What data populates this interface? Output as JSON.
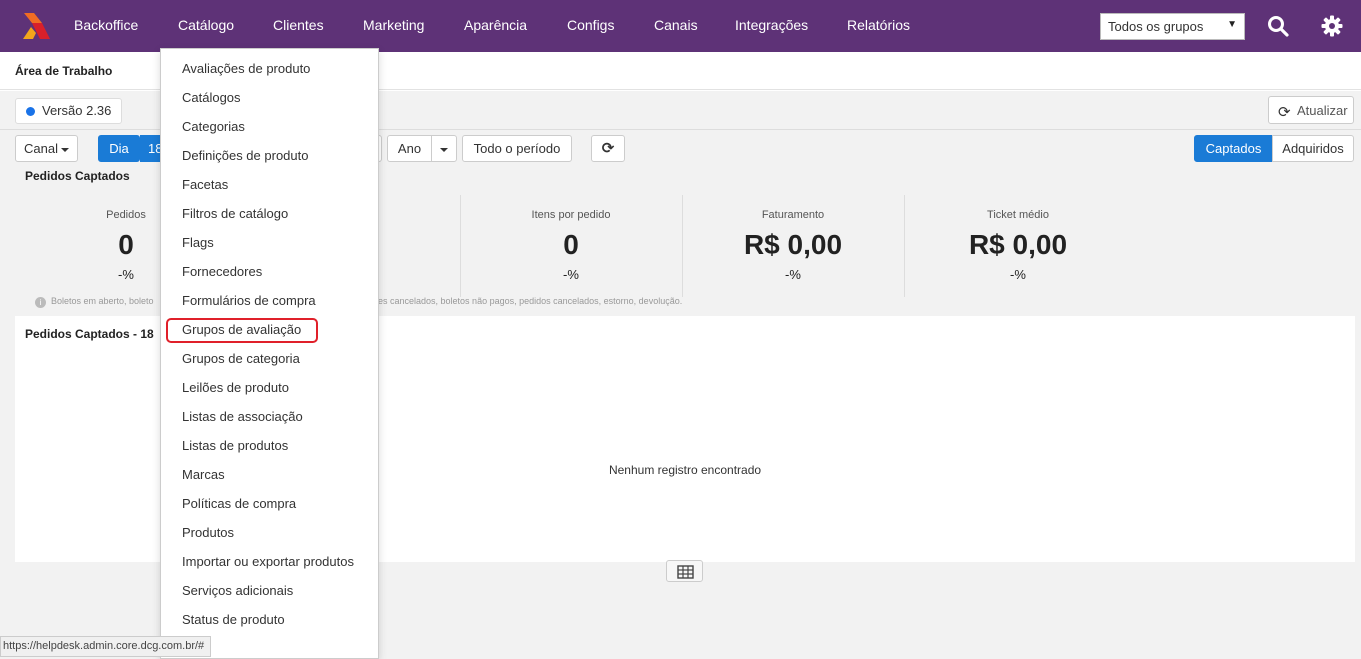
{
  "nav": {
    "items": [
      "Backoffice",
      "Catálogo",
      "Clientes",
      "Marketing",
      "Aparência",
      "Configs",
      "Canais",
      "Integrações",
      "Relatórios"
    ],
    "group_select": "Todos os grupos",
    "icons": [
      "search-icon",
      "gear-icon"
    ],
    "brand_color": "#5e3277"
  },
  "page": {
    "title": "Área de Trabalho",
    "version": "Versão 2.36",
    "refresh_label": "Atualizar"
  },
  "toolbar": {
    "canal": "Canal",
    "dia": "Dia",
    "dia_partial": "18",
    "ano": "Ano",
    "todo_periodo": "Todo o período",
    "captados": "Captados",
    "adquiridos": "Adquiridos"
  },
  "summary": {
    "title": "Pedidos Captados",
    "metrics": [
      {
        "label": "Pedidos",
        "value": "0",
        "pct": "-%"
      },
      {
        "label": "Itens por pedido",
        "value": "0",
        "pct": "-%"
      },
      {
        "label": "Faturamento",
        "value": "R$ 0,00",
        "pct": "-%"
      },
      {
        "label": "Ticket médio",
        "value": "R$ 0,00",
        "pct": "-%"
      }
    ],
    "note_left": "Boletos em aberto, boleto",
    "note_right": "es cancelados, boletos não pagos, pedidos cancelados, estorno, devolução."
  },
  "panel": {
    "title": "Pedidos Captados - 18",
    "empty": "Nenhum registro encontrado"
  },
  "catalog_menu": {
    "items": [
      "Avaliações de produto",
      "Catálogos",
      "Categorias",
      "Definições de produto",
      "Facetas",
      "Filtros de catálogo",
      "Flags",
      "Fornecedores",
      "Formulários de compra",
      "Grupos de avaliação",
      "Grupos de categoria",
      "Leilões de produto",
      "Listas de associação",
      "Listas de produtos",
      "Marcas",
      "Políticas de compra",
      "Produtos",
      "Importar ou exportar produtos",
      "Serviços adicionais",
      "Status de produto"
    ],
    "highlighted": "Grupos de avaliação"
  },
  "status_url": "https://helpdesk.admin.core.dcg.com.br/#"
}
